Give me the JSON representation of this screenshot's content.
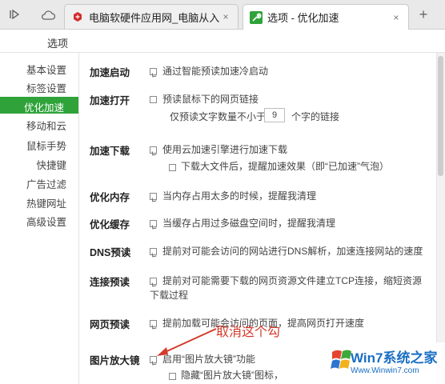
{
  "tabs": [
    {
      "title": "电脑软硬件应用网_电脑从入门",
      "close": "×"
    },
    {
      "title": "选项 - 优化加速",
      "close": "×"
    }
  ],
  "new_tab_label": "+",
  "header": {
    "title": "选项"
  },
  "sidebar": {
    "items": [
      {
        "label": "基本设置"
      },
      {
        "label": "标签设置"
      },
      {
        "label": "优化加速"
      },
      {
        "label": "移动和云"
      },
      {
        "label": "鼠标手势"
      },
      {
        "label": "快捷键"
      },
      {
        "label": "广告过滤"
      },
      {
        "label": "热键网址"
      },
      {
        "label": "高级设置"
      }
    ],
    "active": "优化加速"
  },
  "settings": {
    "speed_start": {
      "label": "加速启动",
      "desc": "通过智能预读加速冷启动",
      "checked": true
    },
    "speed_open": {
      "label": "加速打开",
      "desc": "预读鼠标下的网页链接",
      "checked": false,
      "sub_prefix": "仅预读文字数量不小于",
      "count": "9",
      "sub_suffix": "个字的链接"
    },
    "speed_download": {
      "label": "加速下载",
      "desc": "使用云加速引擎进行加速下载",
      "checked": true,
      "sub": "下载大文件后，提醒加速效果（即“已加速”气泡）",
      "sub_checked": false
    },
    "optimize_memory": {
      "label": "优化内存",
      "desc": "当内存占用太多的时候，提醒我清理",
      "checked": true
    },
    "optimize_cache": {
      "label": "优化缓存",
      "desc": "当缓存占用过多磁盘空间时，提醒我清理",
      "checked": true
    },
    "dns_prefetch": {
      "label": "DNS预读",
      "desc": "提前对可能会访问的网站进行DNS解析，加速连接网站的速度",
      "checked": true
    },
    "connect_prefetch": {
      "label": "连接预读",
      "desc_line1": "提前对可能需要下载的网页资源文件建立TCP连接，缩短资源",
      "desc_line2": "下载过程",
      "checked": true
    },
    "page_prefetch": {
      "label": "网页预读",
      "desc": "提前加载可能会访问的页面，提高网页打开速度",
      "checked": true
    },
    "image_zoom": {
      "label": "图片放大镜",
      "desc": "启用“图片放大镜”功能",
      "checked": true,
      "sub": "隐藏“图片放大镜”图标，",
      "sub_checked": false
    }
  },
  "annotation": {
    "text": "取消这个勾",
    "color": "#d33a2b"
  },
  "watermark": {
    "main": "Win7系统之家",
    "sub": "Www.Winwin7.com"
  },
  "colors": {
    "accent": "#2fa33a",
    "annotation": "#d33a2b"
  }
}
